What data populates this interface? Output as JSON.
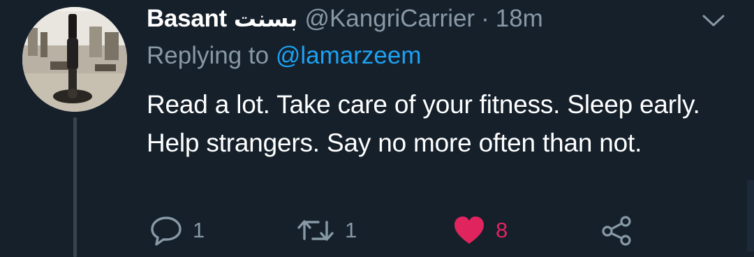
{
  "tweet": {
    "display_name": "Basant",
    "display_name_urdu": "بسنت",
    "handle": "@KangriCarrier",
    "separator": "·",
    "time": "18m",
    "replying_prefix": "Replying to",
    "replying_to": "@lamarzeem",
    "text": "Read a lot. Take care of your fitness. Sleep early. Help strangers. Say no more often than not."
  },
  "actions": {
    "reply_count": "1",
    "retweet_count": "1",
    "like_count": "8",
    "liked": true
  },
  "icons": {
    "caret": "chevron-down-icon",
    "reply": "comment-icon",
    "retweet": "retweet-icon",
    "like": "heart-icon",
    "share": "share-icon"
  },
  "colors": {
    "background": "#15202b",
    "secondary_text": "#8899a6",
    "link": "#1da1f2",
    "like": "#e0245e",
    "thread_line": "#38444d"
  }
}
